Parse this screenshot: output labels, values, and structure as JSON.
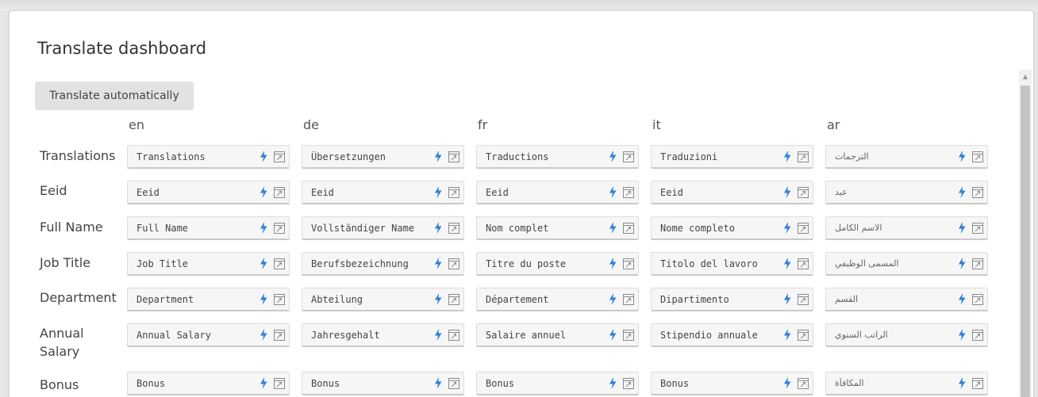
{
  "page": {
    "title": "Translate dashboard"
  },
  "toolbar": {
    "translate_label": "Translate automatically"
  },
  "icons": {
    "translate": "bolt-icon",
    "open": "open-external-icon",
    "scroll_up": "chevron-up-icon"
  },
  "colors": {
    "accent": "#2f7fd6"
  },
  "languages": [
    "en",
    "de",
    "fr",
    "it",
    "ar"
  ],
  "rows": [
    {
      "label": "Translations",
      "values": [
        "Translations",
        "Übersetzungen",
        "Traductions",
        "Traduzioni",
        "الترجمات"
      ]
    },
    {
      "label": "Eeid",
      "values": [
        "Eeid",
        "Eeid",
        "Eeid",
        "Eeid",
        "عيد"
      ]
    },
    {
      "label": "Full Name",
      "values": [
        "Full Name",
        "Vollständiger Name",
        "Nom complet",
        "Nome completo",
        "الاسم الكامل"
      ]
    },
    {
      "label": "Job Title",
      "values": [
        "Job Title",
        "Berufsbezeichnung",
        "Titre du poste",
        "Titolo del lavoro",
        "المسمى الوظيفي"
      ]
    },
    {
      "label": "Department",
      "values": [
        "Department",
        "Abteilung",
        "Département",
        "Dipartimento",
        "القسم"
      ]
    },
    {
      "label": "Annual Salary",
      "values": [
        "Annual Salary",
        "Jahresgehalt",
        "Salaire annuel",
        "Stipendio annuale",
        "الراتب السنوي"
      ]
    },
    {
      "label": "Bonus",
      "values": [
        "Bonus",
        "Bonus",
        "Bonus",
        "Bonus",
        "المكافأة"
      ]
    }
  ]
}
